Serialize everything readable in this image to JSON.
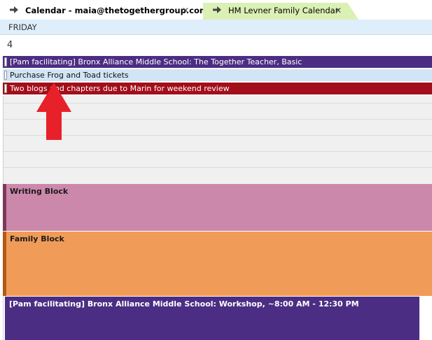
{
  "tabs": [
    {
      "label": "Calendar - maia@thetogethergroup.com",
      "arrow": "arrow-right-icon",
      "close": "✕"
    },
    {
      "label": "HM Levner Family Calendar",
      "arrow": "arrow-right-icon",
      "close": "✕"
    }
  ],
  "day": {
    "name": "FRIDAY",
    "date": "4"
  },
  "all_day_events": [
    {
      "title": "[Pam facilitating] Bronx Alliance Middle School: The Together Teacher, Basic",
      "color": "#4b2e83"
    },
    {
      "title": "Purchase Frog and Toad tickets",
      "color": "#d2e5f6"
    },
    {
      "title": "Two blogs and chapters due to Marin for weekend review",
      "color": "#a20e1a"
    }
  ],
  "timed_events": [
    {
      "title": "Writing Block",
      "color": "#cc88ab"
    },
    {
      "title": "Family Block",
      "color": "#f09c58"
    },
    {
      "title": "[Pam facilitating] Bronx Alliance Middle School: Workshop, ~8:00 AM - 12:30 PM",
      "color": "#4b2e83"
    }
  ],
  "annotation": {
    "icon": "red-up-arrow-icon",
    "color": "#e8202a"
  }
}
